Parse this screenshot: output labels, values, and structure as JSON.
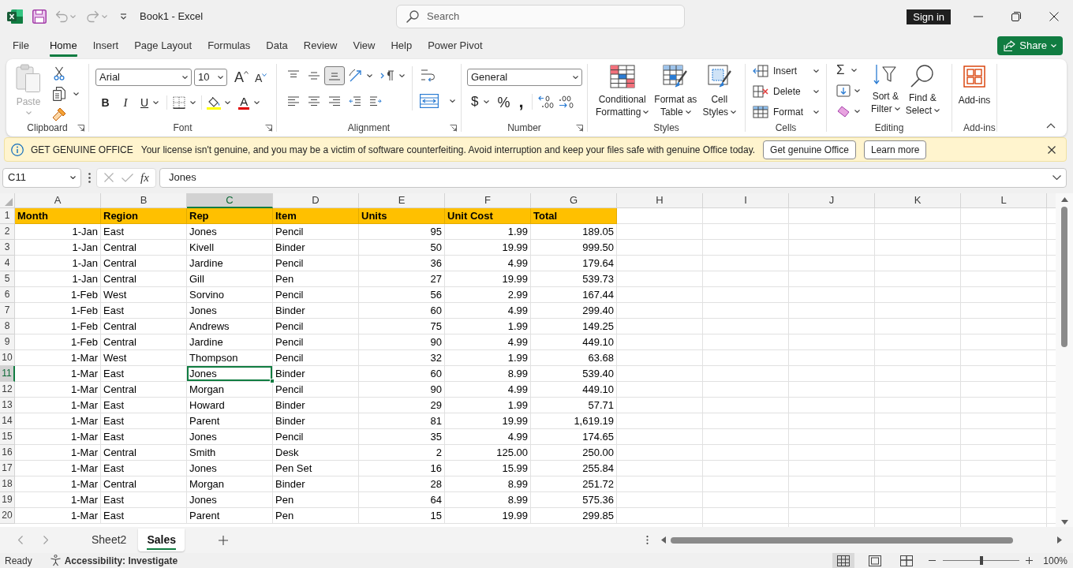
{
  "title_bar": {
    "quick_access": [
      {
        "kind": "save",
        "disabled": false
      },
      {
        "kind": "undo",
        "disabled": true
      },
      {
        "kind": "redo",
        "disabled": true
      }
    ],
    "title": "Book1 - Excel",
    "search": {
      "placeholder": "Search"
    },
    "sign_in": "Sign in"
  },
  "ribbon_tabs": [
    {
      "label": "File",
      "selected": false
    },
    {
      "label": "Home",
      "selected": true
    },
    {
      "label": "Insert",
      "selected": false
    },
    {
      "label": "Page Layout",
      "selected": false
    },
    {
      "label": "Formulas",
      "selected": false
    },
    {
      "label": "Data",
      "selected": false
    },
    {
      "label": "Review",
      "selected": false
    },
    {
      "label": "View",
      "selected": false
    },
    {
      "label": "Help",
      "selected": false
    },
    {
      "label": "Power Pivot",
      "selected": false
    }
  ],
  "share_button": {
    "label": "Share"
  },
  "ribbon": {
    "clipboard": {
      "label": "Clipboard",
      "paste": {
        "label": "Paste",
        "disabled": true
      }
    },
    "font": {
      "label": "Font",
      "font_name": "Arial",
      "font_size": "10",
      "grow_font": "A",
      "shrink_font": "A",
      "styles": [
        {
          "kind": "bold",
          "label": "B"
        },
        {
          "kind": "italic",
          "label": "I"
        },
        {
          "kind": "underline",
          "label": "U"
        }
      ],
      "font_color": "A"
    },
    "alignment": {
      "label": "Alignment",
      "vertical_align": [
        {
          "kind": "top",
          "selected": false
        },
        {
          "kind": "middle",
          "selected": false
        },
        {
          "kind": "bottom",
          "selected": true
        }
      ]
    },
    "number": {
      "label": "Number",
      "format": "General",
      "symbols": [
        {
          "kind": "currency",
          "label": "$"
        },
        {
          "kind": "percent",
          "label": "%"
        },
        {
          "kind": "comma",
          "label": ","
        }
      ]
    },
    "styles": {
      "label": "Styles",
      "buttons": [
        {
          "kind": "conditional",
          "lines": [
            "Conditional",
            "Formatting"
          ]
        },
        {
          "kind": "table",
          "lines": [
            "Format as",
            "Table"
          ]
        },
        {
          "kind": "cell_styles",
          "lines": [
            "Cell",
            "Styles"
          ]
        }
      ]
    },
    "cells": {
      "label": "Cells",
      "buttons": [
        {
          "kind": "insert",
          "label": "Insert"
        },
        {
          "kind": "delete",
          "label": "Delete"
        },
        {
          "kind": "format",
          "label": "Format"
        }
      ]
    },
    "editing": {
      "label": "Editing",
      "autosum": "Σ",
      "buttons": [
        {
          "kind": "sort",
          "lines": [
            "Sort &",
            "Filter"
          ]
        },
        {
          "kind": "find",
          "lines": [
            "Find &",
            "Select"
          ]
        }
      ]
    },
    "add_ins": {
      "label": "Add-ins",
      "button": "Add-ins"
    }
  },
  "banner": {
    "title": "GET GENUINE OFFICE",
    "message": "Your license isn't genuine, and you may be a victim of software counterfeiting. Avoid interruption and keep your files safe with genuine Office today.",
    "buttons": [
      "Get genuine Office",
      "Learn more"
    ]
  },
  "formula_bar": {
    "name_box": "C11",
    "function_label": "fx",
    "value": "Jones"
  },
  "sheet": {
    "columns": [
      {
        "label": "A",
        "selected": false
      },
      {
        "label": "B",
        "selected": false
      },
      {
        "label": "C",
        "selected": true
      },
      {
        "label": "D",
        "selected": false
      },
      {
        "label": "E",
        "selected": false
      },
      {
        "label": "F",
        "selected": false
      },
      {
        "label": "G",
        "selected": false
      },
      {
        "label": "H",
        "selected": false
      },
      {
        "label": "I",
        "selected": false
      },
      {
        "label": "J",
        "selected": false
      },
      {
        "label": "K",
        "selected": false
      },
      {
        "label": "L",
        "selected": false
      }
    ],
    "rows": [
      {
        "number": "1",
        "kind": "header",
        "selected": false,
        "cells": [
          "Month",
          "Region",
          "Rep",
          "Item",
          "Units",
          "Unit Cost",
          "Total"
        ]
      },
      {
        "number": "2",
        "kind": "data",
        "selected": false,
        "cells": [
          "1-Jan",
          "East",
          "Jones",
          "Pencil",
          "95",
          "1.99",
          "189.05"
        ]
      },
      {
        "number": "3",
        "kind": "data",
        "selected": false,
        "cells": [
          "1-Jan",
          "Central",
          "Kivell",
          "Binder",
          "50",
          "19.99",
          "999.50"
        ]
      },
      {
        "number": "4",
        "kind": "data",
        "selected": false,
        "cells": [
          "1-Jan",
          "Central",
          "Jardine",
          "Pencil",
          "36",
          "4.99",
          "179.64"
        ]
      },
      {
        "number": "5",
        "kind": "data",
        "selected": false,
        "cells": [
          "1-Jan",
          "Central",
          "Gill",
          "Pen",
          "27",
          "19.99",
          "539.73"
        ]
      },
      {
        "number": "6",
        "kind": "data",
        "selected": false,
        "cells": [
          "1-Feb",
          "West",
          "Sorvino",
          "Pencil",
          "56",
          "2.99",
          "167.44"
        ]
      },
      {
        "number": "7",
        "kind": "data",
        "selected": false,
        "cells": [
          "1-Feb",
          "East",
          "Jones",
          "Binder",
          "60",
          "4.99",
          "299.40"
        ]
      },
      {
        "number": "8",
        "kind": "data",
        "selected": false,
        "cells": [
          "1-Feb",
          "Central",
          "Andrews",
          "Pencil",
          "75",
          "1.99",
          "149.25"
        ]
      },
      {
        "number": "9",
        "kind": "data",
        "selected": false,
        "cells": [
          "1-Feb",
          "Central",
          "Jardine",
          "Pencil",
          "90",
          "4.99",
          "449.10"
        ]
      },
      {
        "number": "10",
        "kind": "data",
        "selected": false,
        "cells": [
          "1-Mar",
          "West",
          "Thompson",
          "Pencil",
          "32",
          "1.99",
          "63.68"
        ]
      },
      {
        "number": "11",
        "kind": "data",
        "selected": true,
        "cells": [
          "1-Mar",
          "East",
          "Jones",
          "Binder",
          "60",
          "8.99",
          "539.40"
        ]
      },
      {
        "number": "12",
        "kind": "data",
        "selected": false,
        "cells": [
          "1-Mar",
          "Central",
          "Morgan",
          "Pencil",
          "90",
          "4.99",
          "449.10"
        ]
      },
      {
        "number": "13",
        "kind": "data",
        "selected": false,
        "cells": [
          "1-Mar",
          "East",
          "Howard",
          "Binder",
          "29",
          "1.99",
          "57.71"
        ]
      },
      {
        "number": "14",
        "kind": "data",
        "selected": false,
        "cells": [
          "1-Mar",
          "East",
          "Parent",
          "Binder",
          "81",
          "19.99",
          "1,619.19"
        ]
      },
      {
        "number": "15",
        "kind": "data",
        "selected": false,
        "cells": [
          "1-Mar",
          "East",
          "Jones",
          "Pencil",
          "35",
          "4.99",
          "174.65"
        ]
      },
      {
        "number": "16",
        "kind": "data",
        "selected": false,
        "cells": [
          "1-Mar",
          "Central",
          "Smith",
          "Desk",
          "2",
          "125.00",
          "250.00"
        ]
      },
      {
        "number": "17",
        "kind": "data",
        "selected": false,
        "cells": [
          "1-Mar",
          "East",
          "Jones",
          "Pen Set",
          "16",
          "15.99",
          "255.84"
        ]
      },
      {
        "number": "18",
        "kind": "data",
        "selected": false,
        "cells": [
          "1-Mar",
          "Central",
          "Morgan",
          "Binder",
          "28",
          "8.99",
          "251.72"
        ]
      },
      {
        "number": "19",
        "kind": "data",
        "selected": false,
        "cells": [
          "1-Mar",
          "East",
          "Jones",
          "Pen",
          "64",
          "8.99",
          "575.36"
        ]
      },
      {
        "number": "20",
        "kind": "data",
        "selected": false,
        "cells": [
          "1-Mar",
          "East",
          "Parent",
          "Pen",
          "15",
          "19.99",
          "299.85"
        ]
      }
    ]
  },
  "sheet_tabs": [
    {
      "label": "Sheet2",
      "selected": false
    },
    {
      "label": "Sales",
      "selected": true
    }
  ],
  "status_bar": {
    "mode": "Ready",
    "accessibility": "Accessibility: Investigate",
    "view_buttons": [
      {
        "kind": "normal",
        "selected": true
      },
      {
        "kind": "page_layout",
        "selected": false
      },
      {
        "kind": "page_break",
        "selected": false
      }
    ],
    "zoom": {
      "level": 0.5,
      "label": "100%"
    }
  }
}
